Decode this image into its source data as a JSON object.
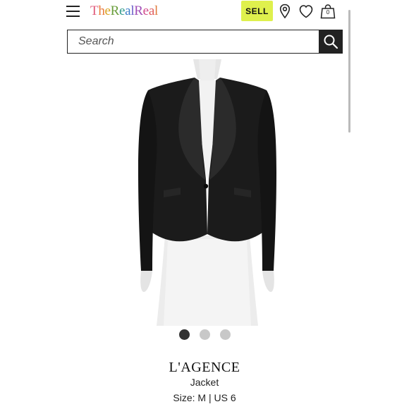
{
  "header": {
    "logo_letters": [
      {
        "ch": "T",
        "color": "#e05a7a"
      },
      {
        "ch": "h",
        "color": "#e97a3a"
      },
      {
        "ch": "e",
        "color": "#d9a21f"
      },
      {
        "ch": "R",
        "color": "#6a9e3c"
      },
      {
        "ch": "e",
        "color": "#2f9a8c"
      },
      {
        "ch": "a",
        "color": "#3a7cc9"
      },
      {
        "ch": "l",
        "color": "#6a5ac8"
      },
      {
        "ch": "R",
        "color": "#a14fb8"
      },
      {
        "ch": "e",
        "color": "#d14a8c"
      },
      {
        "ch": "a",
        "color": "#e05a5a"
      },
      {
        "ch": "l",
        "color": "#e07a3a"
      }
    ],
    "sell_label": "SELL",
    "bag_count": "0",
    "icons": [
      "hamburger-menu-icon",
      "location-pin-icon",
      "heart-icon",
      "shopping-bag-icon"
    ]
  },
  "search": {
    "placeholder": "Search",
    "icon": "search-icon"
  },
  "colors": {
    "sell_bg": "#dff04d",
    "dark": "#222222",
    "dot_active": "#333333",
    "dot_inactive": "#c8c8c8"
  },
  "carousel": {
    "total": 3,
    "active_index": 0
  },
  "product": {
    "brand": "L'AGENCE",
    "type": "Jacket",
    "size": "Size: M | US 6"
  }
}
